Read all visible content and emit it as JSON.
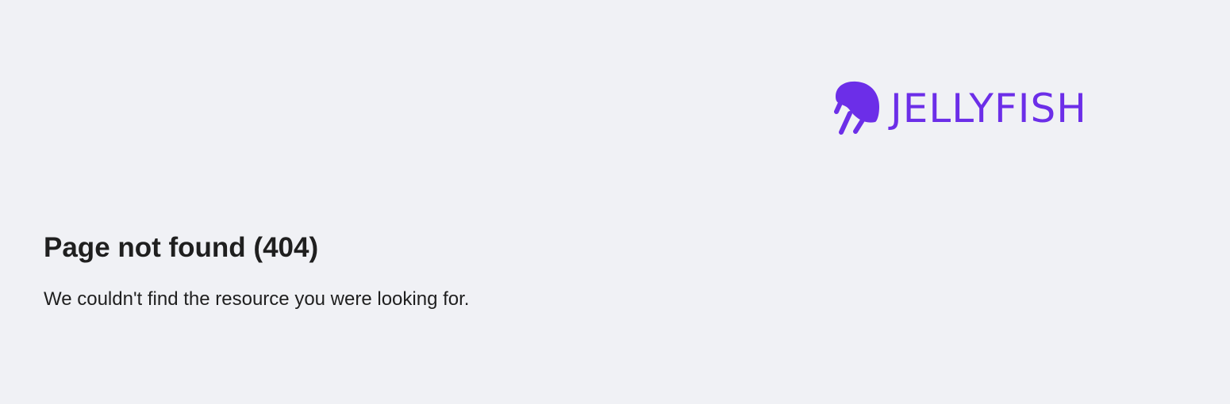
{
  "brand": {
    "name": "JELLYFISH",
    "logo_icon": "jellyfish-icon",
    "color": "#6c2ee8"
  },
  "error": {
    "title": "Page not found (404)",
    "message": "We couldn't find the resource you were looking for."
  },
  "colors": {
    "background": "#f0f1f5",
    "text": "#1f1f1f"
  }
}
